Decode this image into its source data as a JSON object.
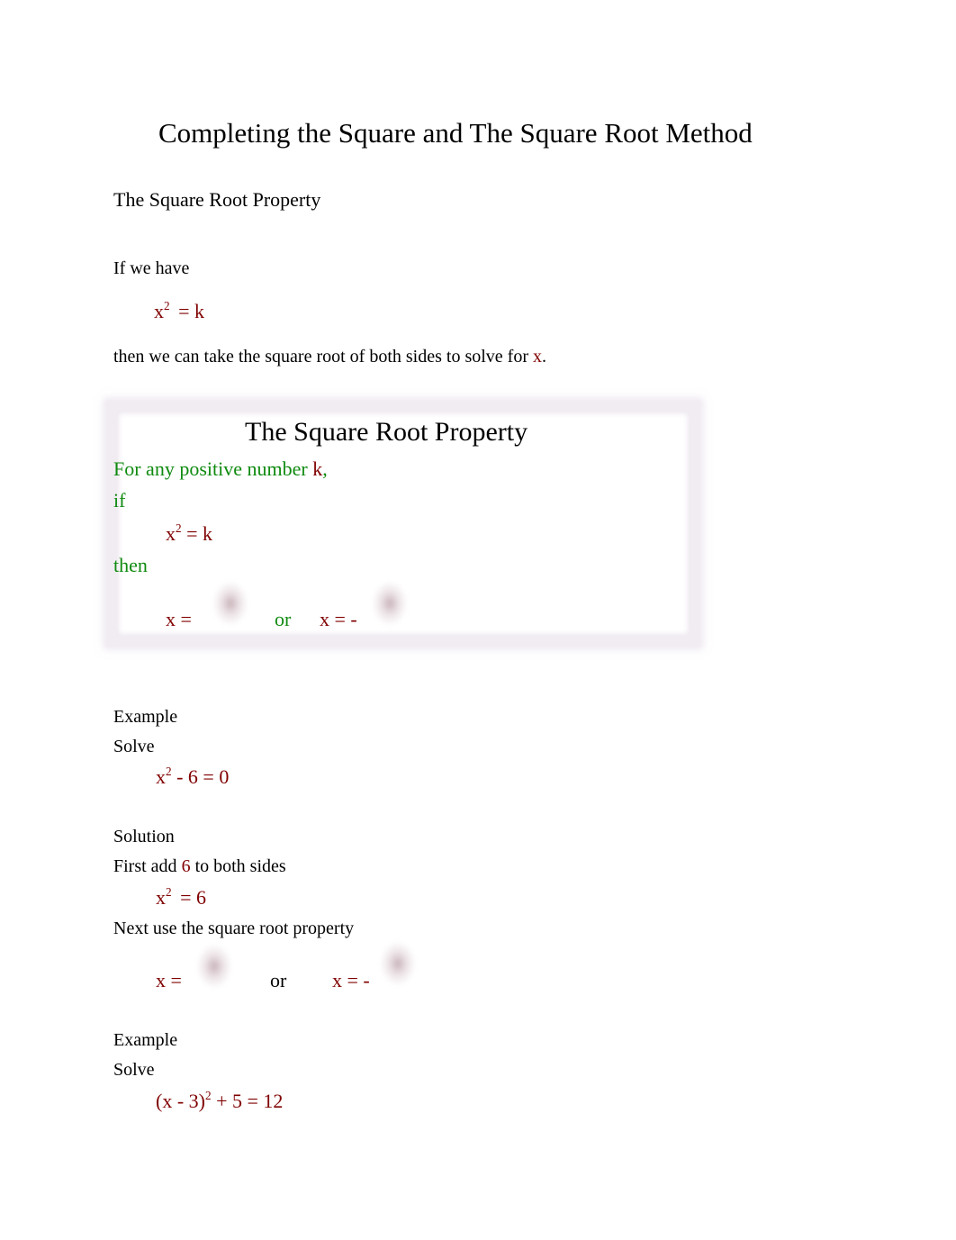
{
  "title": "Completing the Square and The Square Root Method",
  "section_heading": "The Square Root Property",
  "intro": {
    "if_we_have": "If we have",
    "equation": {
      "base": "x",
      "exp": "2",
      "rest": " = k"
    },
    "then_text": "then we can take the square root of both sides to solve for",
    "then_var": "x",
    "then_end": "."
  },
  "property_box": {
    "title": "The Square Root Property",
    "condition_text": "For any positive number",
    "condition_var": "k",
    "condition_end": ",",
    "if_label": "if",
    "equation": {
      "base": "x",
      "exp": "2",
      "rest": " = k"
    },
    "then_label": "then",
    "solution_left": "x =",
    "or_label": "or",
    "solution_right": "x = -",
    "sqrt_image_label": "sqrt-k"
  },
  "example1": {
    "label": "Example",
    "solve_label": "Solve",
    "equation": {
      "base": "x",
      "exp": "2",
      "rest": " - 6 = 0"
    },
    "solution_label": "Solution",
    "step1_prefix": "First add",
    "step1_value": "6",
    "step1_suffix": "to both sides",
    "step1_equation": {
      "base": "x",
      "exp": "2",
      "rest": " = 6"
    },
    "step2_text": "Next use the square root property",
    "solution_left": "x =",
    "or_label": "or",
    "solution_right": "x = -",
    "sqrt_image_label": "sqrt-6"
  },
  "example2": {
    "label": "Example",
    "solve_label": "Solve",
    "equation": {
      "base": "(x - 3)",
      "exp": "2",
      "rest": " + 5 = 12"
    }
  },
  "colors": {
    "math_red": "#800000",
    "highlight_green": "#0f8a0f",
    "box_border": "#f0ecf1"
  }
}
